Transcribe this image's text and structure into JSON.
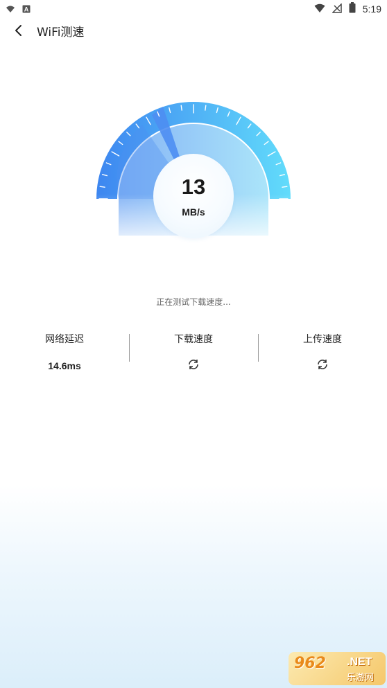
{
  "status_bar": {
    "time": "5:19"
  },
  "header": {
    "title": "WiFi测速"
  },
  "gauge": {
    "speed_value": "13",
    "speed_unit": "MB/s"
  },
  "status_text": "正在测试下载速度...",
  "stats": {
    "latency_label": "网络延迟",
    "latency_value": "14.6ms",
    "download_label": "下载速度",
    "upload_label": "上传速度"
  },
  "watermark": {
    "brand": "962",
    "net": ".NET",
    "sub": "乐游网"
  },
  "colors": {
    "gauge_start": "#3d86f0",
    "gauge_end": "#62dcfb",
    "accent": "#4a9df2"
  }
}
